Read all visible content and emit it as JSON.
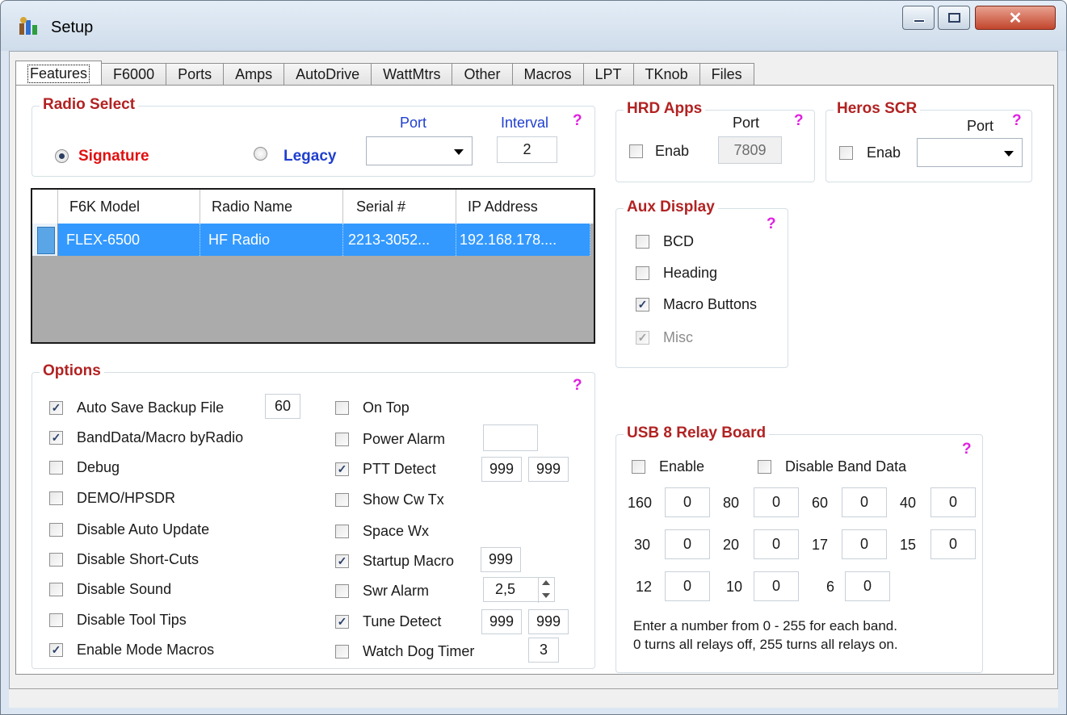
{
  "window": {
    "title": "Setup",
    "colors": {
      "accent_red": "#b22222",
      "help": "#e020e0",
      "select": "#3399ff",
      "legacy_blue": "#1f3fcf"
    }
  },
  "tabs": [
    "Features",
    "F6000",
    "Ports",
    "Amps",
    "AutoDrive",
    "WattMtrs",
    "Other",
    "Macros",
    "LPT",
    "TKnob",
    "Files"
  ],
  "radio_select": {
    "title": "Radio Select",
    "signature_label": "Signature",
    "legacy_label": "Legacy",
    "port_label": "Port",
    "interval_label": "Interval",
    "interval_value": "2",
    "help": "?",
    "selected": "Signature"
  },
  "radio_grid": {
    "headers": [
      "F6K Model",
      "Radio Name",
      "Serial #",
      "IP Address"
    ],
    "rows": [
      [
        "FLEX-6500",
        "HF Radio",
        "2213-3052...",
        "192.168.178...."
      ]
    ]
  },
  "hrd_apps": {
    "title": "HRD Apps",
    "port_label": "Port",
    "help": "?",
    "enab_label": "Enab",
    "port_value": "7809"
  },
  "heros_scr": {
    "title": "Heros SCR",
    "port_label": "Port",
    "help": "?",
    "enab_label": "Enab"
  },
  "aux_display": {
    "title": "Aux Display",
    "help": "?",
    "items": [
      {
        "label": "BCD",
        "checked": false
      },
      {
        "label": "Heading",
        "checked": false
      },
      {
        "label": "Macro Buttons",
        "checked": true
      },
      {
        "label": "Misc",
        "checked": true,
        "disabled": true
      }
    ]
  },
  "options": {
    "title": "Options",
    "help": "?",
    "left": [
      {
        "label": "Auto Save Backup File",
        "checked": true,
        "value": "60"
      },
      {
        "label": "BandData/Macro byRadio",
        "checked": true
      },
      {
        "label": "Debug",
        "checked": false
      },
      {
        "label": "DEMO/HPSDR",
        "checked": false
      },
      {
        "label": "Disable Auto Update",
        "checked": false
      },
      {
        "label": "Disable Short-Cuts",
        "checked": false
      },
      {
        "label": "Disable Sound",
        "checked": false
      },
      {
        "label": "Disable Tool Tips",
        "checked": false
      },
      {
        "label": "Enable Mode Macros",
        "checked": true
      }
    ],
    "right": [
      {
        "label": "On Top",
        "checked": false
      },
      {
        "label": "Power Alarm",
        "checked": false,
        "value": ""
      },
      {
        "label": "PTT Detect",
        "checked": true,
        "v1": "999",
        "v2": "999"
      },
      {
        "label": "Show Cw Tx",
        "checked": false
      },
      {
        "label": "Space Wx",
        "checked": false
      },
      {
        "label": "Startup Macro",
        "checked": true,
        "value": "999"
      },
      {
        "label": "Swr Alarm",
        "checked": false,
        "value": "2,5"
      },
      {
        "label": "Tune Detect",
        "checked": true,
        "v1": "999",
        "v2": "999"
      },
      {
        "label": "Watch Dog Timer",
        "checked": false,
        "value": "3"
      }
    ]
  },
  "relay_board": {
    "title": "USB 8 Relay Board",
    "help": "?",
    "enable_label": "Enable",
    "disable_band_label": "Disable Band Data",
    "bands": [
      {
        "band": "160",
        "value": "0"
      },
      {
        "band": "80",
        "value": "0"
      },
      {
        "band": "60",
        "value": "0"
      },
      {
        "band": "40",
        "value": "0"
      },
      {
        "band": "30",
        "value": "0"
      },
      {
        "band": "20",
        "value": "0"
      },
      {
        "band": "17",
        "value": "0"
      },
      {
        "band": "15",
        "value": "0"
      },
      {
        "band": "12",
        "value": "0"
      },
      {
        "band": "10",
        "value": "0"
      },
      {
        "band": "6",
        "value": "0"
      }
    ],
    "note1": "Enter a number from 0 - 255 for each band.",
    "note2": "0 turns all relays off, 255 turns all relays on."
  }
}
